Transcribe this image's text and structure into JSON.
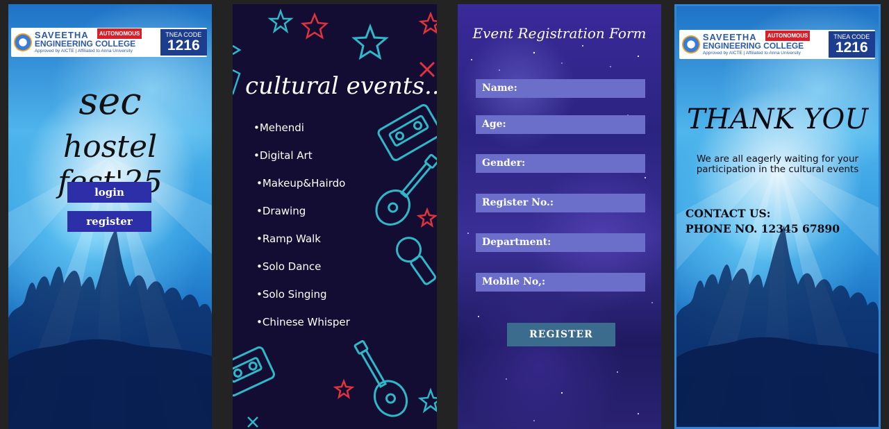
{
  "logo": {
    "college_line1": "SAVEETHA",
    "college_line2": "ENGINEERING COLLEGE",
    "autonomous": "AUTONOMOUS",
    "approval": "Approved by AICTE | Affiliated to Anna University",
    "tnea_label": "TNEA CODE",
    "tnea_code": "1216"
  },
  "home": {
    "title_line1": "sec",
    "title_line2": "hostel fest'25",
    "login_label": "login",
    "register_label": "register"
  },
  "events": {
    "heading": "cultural events....",
    "items": [
      "•Mehendi",
      "•Digital Art",
      "•Makeup&Hairdo",
      "•Drawing",
      "•Ramp Walk",
      "•Solo Dance",
      "•Solo Singing",
      "•Chinese Whisper"
    ]
  },
  "form": {
    "title": "Event Registration Form",
    "fields": {
      "name": "Name:",
      "age": "Age:",
      "gender": "Gender:",
      "register_no": "Register No.:",
      "department": "Department:",
      "mobile": "Mobile No,:"
    },
    "submit_label": "REGISTER"
  },
  "thanks": {
    "title": "THANK YOU",
    "message": "We are all eagerly waiting for your participation in the cultural events",
    "contact_label": "CONTACT US:",
    "phone": "PHONE NO. 12345 67890"
  },
  "colors": {
    "page_bg": "#232323",
    "button_blue": "#2c2fa8",
    "events_bg": "#130d33",
    "neon_cyan": "#2fb8c8",
    "neon_red": "#e0333b",
    "form_field": "#6b6fc9",
    "register_button": "#3b6b8d",
    "selected_border": "#2f86d6"
  }
}
